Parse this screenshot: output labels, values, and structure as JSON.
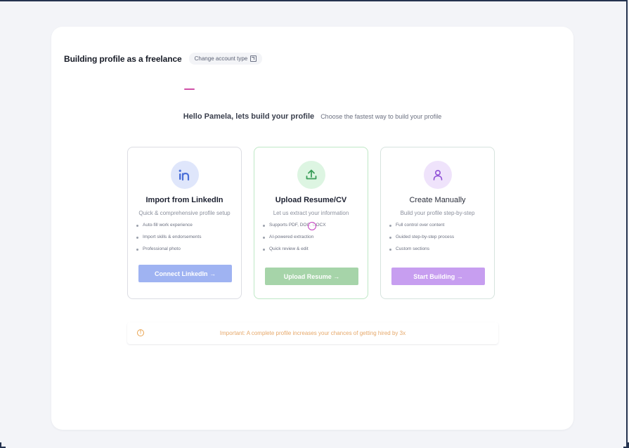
{
  "header": {
    "title": "Building profile as a freelance",
    "change_account": "Change account type"
  },
  "greeting": {
    "main": "Hello Pamela, lets build your profile",
    "sub": "Choose the fastest way to build your profile"
  },
  "options": [
    {
      "title": "Import from LinkedIn",
      "description": "Quick & comprehensive profile setup",
      "features": [
        "Auto-fill work experience",
        "Import skills & endorsements",
        "Professional photo"
      ],
      "button": "Connect LinkedIn →",
      "icon": "linkedin-icon",
      "icon_bg": "#dfe6fb",
      "icon_color": "#4a6fd8",
      "button_color": "#9fb3f2"
    },
    {
      "title": "Upload Resume/CV",
      "description": "Let us extract your information",
      "features": [
        "Supports PDF, DOC, DOCX",
        "AI-powered extraction",
        "Quick review & edit"
      ],
      "button": "Upload Resume →",
      "icon": "upload-icon",
      "icon_bg": "#ddf5e2",
      "icon_color": "#3b9e5a",
      "button_color": "#a6d4a9"
    },
    {
      "title": "Create Manually",
      "description": "Build your profile step-by-step",
      "features": [
        "Full control over content",
        "Guided step-by-step process",
        "Custom sections"
      ],
      "button": "Start Building →",
      "icon": "user-icon",
      "icon_bg": "#efe3fb",
      "icon_color": "#8f4fd6",
      "button_color": "#c79ef0"
    }
  ],
  "notice": {
    "text": "Important: A complete profile increases your chances of getting hired by 3x",
    "icon": "alert-icon",
    "icon_glyph": "!"
  }
}
